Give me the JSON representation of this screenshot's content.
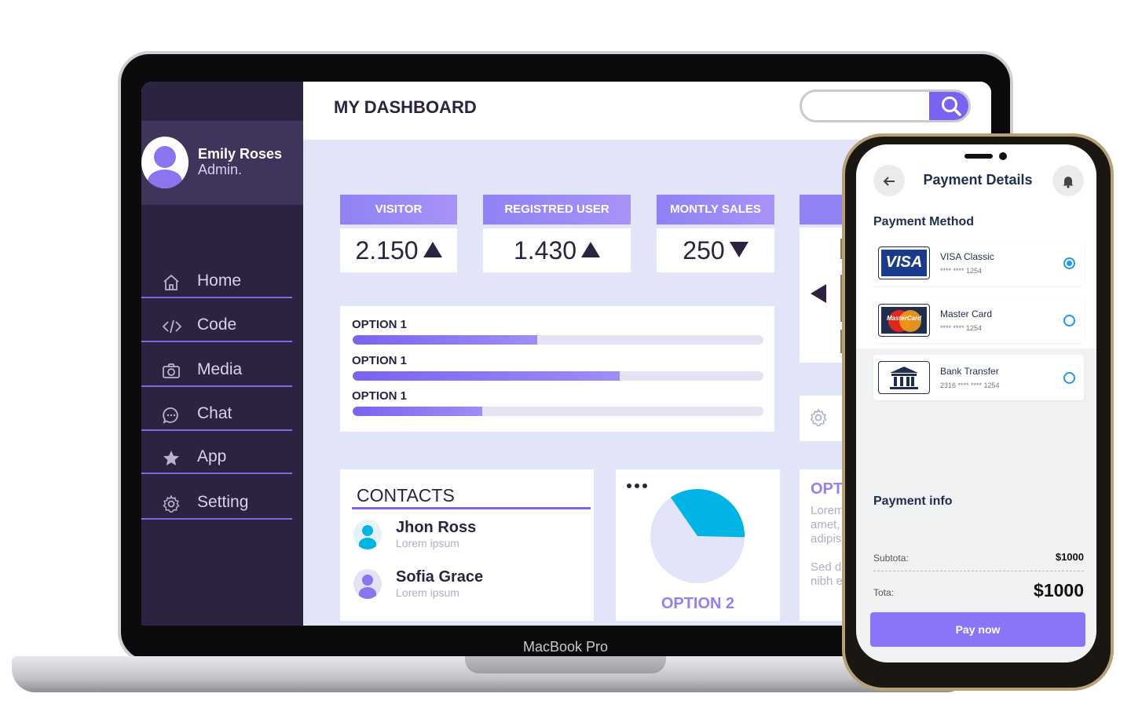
{
  "laptop": {
    "brand": "MacBook Pro"
  },
  "sidebar": {
    "user_name": "Emily Roses",
    "user_role": "Admin.",
    "items": [
      {
        "label": "Home",
        "icon": "home-icon"
      },
      {
        "label": "Code",
        "icon": "code-icon"
      },
      {
        "label": "Media",
        "icon": "camera-icon"
      },
      {
        "label": "Chat",
        "icon": "chat-icon"
      },
      {
        "label": "App",
        "icon": "star-icon"
      },
      {
        "label": "Setting",
        "icon": "gear-icon"
      }
    ]
  },
  "header": {
    "title": "MY DASHBOARD",
    "search_placeholder": ""
  },
  "stats": [
    {
      "label": "VISITOR",
      "value": "2.150",
      "trend": "up"
    },
    {
      "label": "REGISTRED USER",
      "value": "1.430",
      "trend": "up"
    },
    {
      "label": "MONTLY SALES",
      "value": "250",
      "trend": "down"
    }
  ],
  "options": [
    {
      "label": "OPTION 1",
      "fill": 0.45
    },
    {
      "label": "OPTION 1",
      "fill": 0.65
    },
    {
      "label": "OPTION 1",
      "fill": 0.315
    }
  ],
  "contacts": {
    "title": "CONTACTS",
    "items": [
      {
        "name": "Jhon Ross",
        "sub": "Lorem ipsum"
      },
      {
        "name": "Sofia Grace",
        "sub": "Lorem ipsum"
      }
    ]
  },
  "pie": {
    "label": "OPTION 2",
    "highlight_fraction": 0.35,
    "colors": {
      "highlight": "#00b4e6",
      "rest": "#e2e5f7"
    }
  },
  "cut_card": {
    "title": "OPT",
    "lines": [
      "Lorem",
      "amet,",
      "adipis",
      "",
      "Sed d",
      "nibh e"
    ]
  },
  "phone": {
    "title": "Payment Details",
    "method_title": "Payment Method",
    "methods": [
      {
        "name": "VISA Classic",
        "number": "**** **** 1254",
        "logo": "VISA",
        "selected": true
      },
      {
        "name": "Master Card",
        "number": "**** **** 1254",
        "logo": "MasterCard",
        "selected": false
      },
      {
        "name": "Bank Transfer",
        "number": "2316 **** **** 1254",
        "logo": "bank-icon",
        "selected": false
      }
    ],
    "info_title": "Payment info",
    "subtotal_label": "Subtota:",
    "subtotal_value": "$1000",
    "total_label": "Tota:",
    "total_value": "$1000",
    "pay_button": "Pay now"
  },
  "colors": {
    "accent": "#7b62f0",
    "sidebar": "#2c2340",
    "screen_bg": "#e2e5f7",
    "radio": "#1f97f0"
  }
}
